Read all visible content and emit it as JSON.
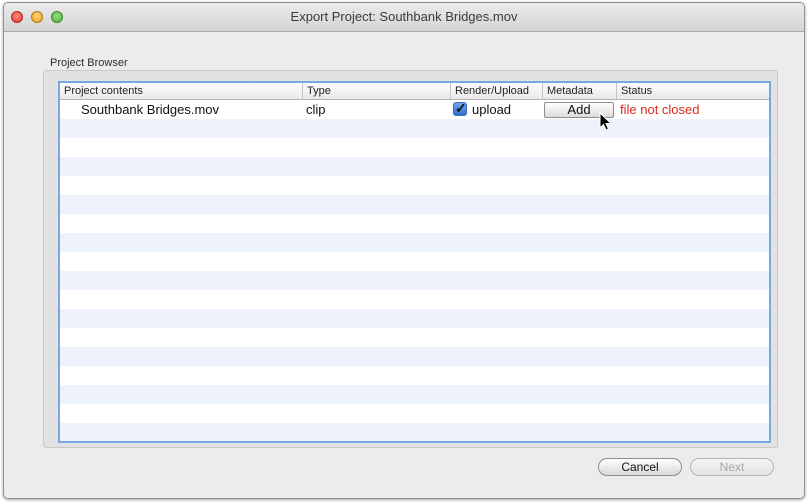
{
  "window": {
    "title": "Export Project: Southbank Bridges.mov"
  },
  "project_browser": {
    "label": "Project Browser",
    "columns": [
      "Project contents",
      "Type",
      "Render/Upload",
      "Metadata",
      "Status"
    ],
    "rows": [
      {
        "contents": "Southbank Bridges.mov",
        "type": "clip",
        "render_upload_checked": true,
        "render_upload_label": "upload",
        "metadata_button": "Add",
        "status": "file not closed"
      }
    ]
  },
  "buttons": {
    "cancel": "Cancel",
    "next": "Next"
  },
  "colors": {
    "status_error": "#e0281b",
    "table_focus_border": "#7aa7df",
    "row_stripe": "#eef3fb"
  }
}
